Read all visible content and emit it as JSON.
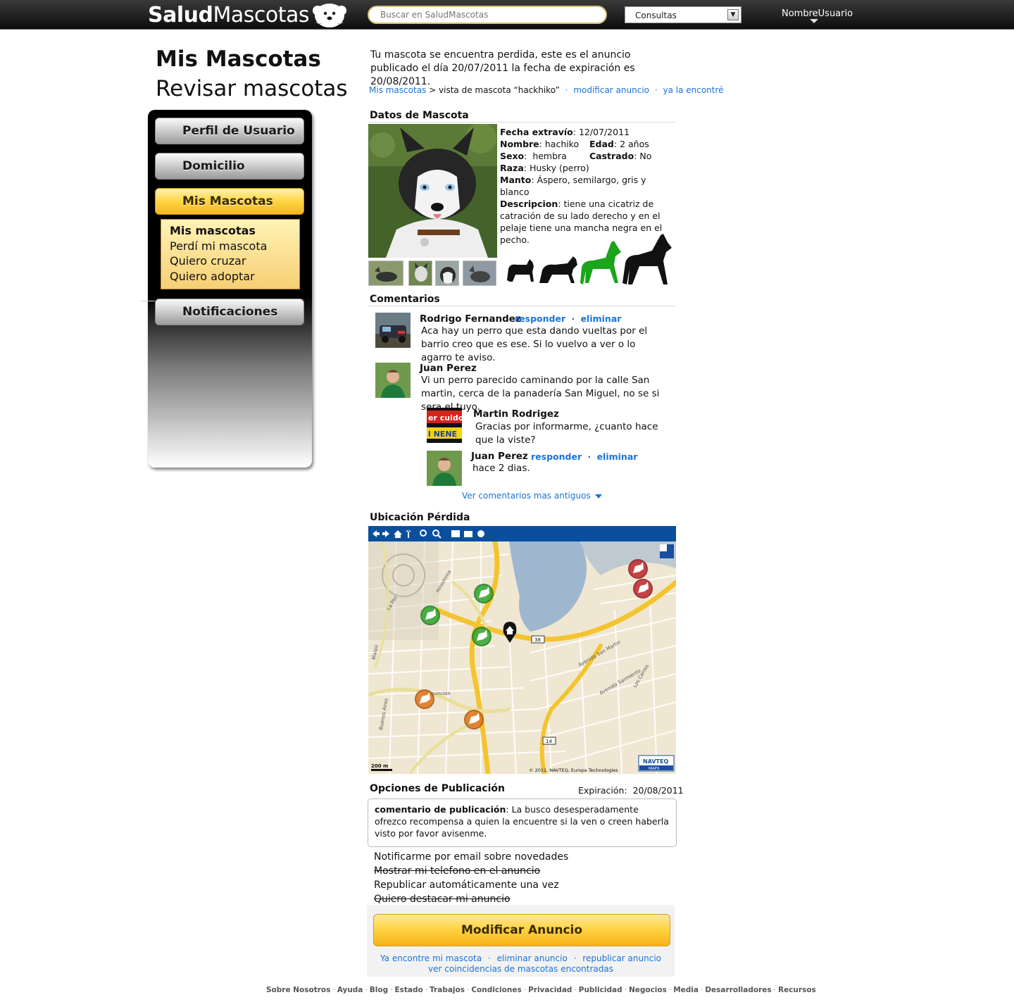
{
  "header": {
    "logo_bold": "Salud",
    "logo_light": "Mascotas",
    "search_placeholder": "Buscar en SaludMascotas",
    "select_value": "Consultas",
    "username": "NombreUsuario"
  },
  "page": {
    "title": "Mis Mascotas",
    "subtitle": "Revisar mascotas"
  },
  "sidebar": {
    "buttons": [
      "Perfil de Usuario",
      "Domicilio",
      "Mis Mascotas",
      "Notificaciones"
    ],
    "submenu": [
      "Mis mascotas",
      "Perdí mi mascota",
      "Quiero cruzar",
      "Quiero adoptar"
    ]
  },
  "intro": "Tu mascota se encuentra perdida, este es el anuncio publicado el día 20/07/2011 la fecha de expiración es 20/08/2011.",
  "breadcrumb": {
    "link": "Mis mascotas",
    "sep": ">",
    "current": "vista de mascota “hackhiko”",
    "action1": "modificar anuncio",
    "action2": "ya la encontré",
    "dot": "·"
  },
  "pet": {
    "section_title": "Datos de Mascota",
    "fecha_label": "Fecha extravío",
    "fecha": "12/07/2011",
    "nombre_label": "Nombre",
    "nombre": "hachiko",
    "edad_label": "Edad",
    "edad": "2 años",
    "sexo_label": "Sexo",
    "sexo": "hembra",
    "castrado_label": "Castrado",
    "castrado": "No",
    "raza_label": "Raza",
    "raza": "Husky (perro)",
    "manto_label": "Manto",
    "manto": "Áspero, semilargo, gris y blanco",
    "desc_label": "Descripcion",
    "desc": "tiene una cicatriz de catración de su lado derecho y en el pelaje tiene una mancha negra en el pecho.",
    "size_selected": 3,
    "size_colors": {
      "default": "#111111",
      "selected": "#1aa51a"
    }
  },
  "comments": {
    "section_title": "Comentarios",
    "responder": "responder",
    "eliminar": "eliminar",
    "dot": "·",
    "items": [
      {
        "name": "Rodrigo Fernandez",
        "text": "Aca hay un perro que esta dando vueltas por el barrio creo que es ese. Si lo vuelvo a ver o lo agarro te aviso."
      },
      {
        "name": "Juan Perez",
        "text": "Vi un perro parecido caminando por la calle San martin, cerca de la panadería San Miguel, no se si sera el tuyo."
      },
      {
        "name": "Martin Rodrigez",
        "text": "Gracias por informarme, ¿cuanto hace que la viste?",
        "avatar_text_1": "er cuido",
        "avatar_text_2": "l NENE"
      },
      {
        "name": "Juan Perez",
        "text": "hace 2 dias."
      }
    ],
    "more": "Ver comentarios mas antiguos"
  },
  "map": {
    "section_title": "Ubicación Pérdida",
    "scale": "200 m",
    "copyright": "© 2011, NAVTEQ, Europa Technologies",
    "brand_1": "NAVTEQ",
    "brand_2": "MAPS",
    "route_1": "38",
    "route_2": "14",
    "street_labels": [
      "Avenida San Martin",
      "Avenida Sarmiento",
      "Asunción",
      "Buenos Aires",
      "La Paz",
      "Hiroshima",
      "Maipú",
      "Los Cerros"
    ],
    "colors": {
      "bar": "#0a4f9e",
      "road_main": "#f4c430",
      "green_pin": "#2fa52f",
      "orange_pin": "#e0731a",
      "red_pin": "#c0262d"
    }
  },
  "options": {
    "section_title": "Opciones de Publicación",
    "expiracion_label": "Expiración:",
    "expiracion": "20/08/2011",
    "comment_label": "comentario de publicación",
    "comment": "La busco desesperadamente ofrezco recompensa a quien la encuentre si la ven o creen haberla visto por favor avisenme.",
    "items": [
      {
        "label": "Notificarme por email sobre novedades",
        "disabled": false
      },
      {
        "label": "Mostrar mi telefono en el anuncio",
        "disabled": true
      },
      {
        "label": "Republicar automáticamente una vez",
        "disabled": false
      },
      {
        "label": "Quiero destacar mi anuncio",
        "disabled": true
      }
    ],
    "button": "Modificar Anuncio",
    "link1": "Ya encontre mi mascota",
    "link2": "eliminar anuncio",
    "link3": "republicar anuncio",
    "link4": "ver coincidencias de mascotas encontradas",
    "dot": "·"
  },
  "footer": [
    "Sobre Nosotros",
    "Ayuda",
    "Blog",
    "Estado",
    "Trabajos",
    "Condiciones",
    "Privacidad",
    "Publicidad",
    "Negocios",
    "Media",
    "Desarrolladores",
    "Recursos"
  ],
  "footer_sep": "·"
}
